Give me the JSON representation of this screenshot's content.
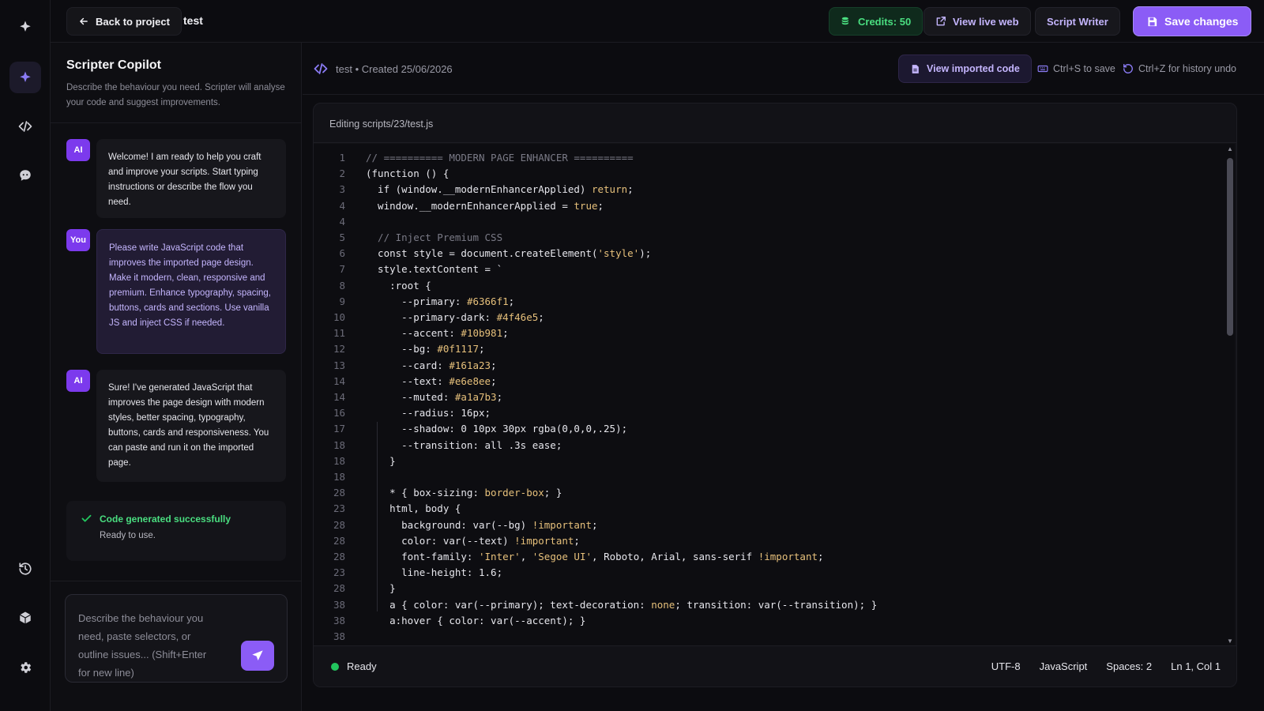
{
  "topbar": {
    "back_label": "Back to project",
    "project_name": "test",
    "credits_label": "Credits: 50",
    "live_label": "View live web",
    "writer_label": "Script Writer",
    "save_label": "Save changes"
  },
  "rail": {
    "items": [
      "logo-icon",
      "copilot-icon",
      "code-icon",
      "chat-icon",
      "history-icon",
      "package-icon",
      "settings-icon"
    ]
  },
  "copilot": {
    "title": "Scripter Copilot",
    "description": "Describe the behaviour you need. Scripter will analyse your code and suggest improvements.",
    "messages": [
      {
        "role": "AI",
        "text": "Welcome! I am ready to help you craft and improve your scripts. Start typing instructions or describe the flow you need."
      },
      {
        "role": "You",
        "text": "Please write JavaScript code that improves the imported page design. Make it modern, clean, responsive and premium. Enhance typography, spacing, buttons, cards and sections. Use vanilla JS and inject CSS if needed."
      },
      {
        "role": "AI",
        "text": "Sure! I've generated JavaScript that improves the page design with modern styles, better spacing, typography, buttons, cards and responsiveness. You can paste and run it on the imported page."
      }
    ],
    "success_title": "Code generated successfully",
    "success_sub": "Ready to use.",
    "input_placeholder": "Describe the behaviour you need, paste selectors, or outline issues... (Shift+Enter for new line)"
  },
  "editor_header": {
    "file_meta": "test • Created 25/06/2026",
    "view_imported_label": "View imported code",
    "save_hint": "Ctrl+S to save",
    "undo_hint": "Ctrl+Z for history undo"
  },
  "editor": {
    "path": "Editing scripts/23/test.js",
    "lines": [
      {
        "n": "1",
        "t": "// ========== MODERN PAGE ENHANCER =========="
      },
      {
        "n": "2",
        "t": "(function () {"
      },
      {
        "n": "3",
        "t": "  if (window.__modernEnhancerApplied) return;"
      },
      {
        "n": "4",
        "t": "  window.__modernEnhancerApplied = true;"
      },
      {
        "n": "4",
        "t": ""
      },
      {
        "n": "5",
        "t": "  // Inject Premium CSS"
      },
      {
        "n": "6",
        "t": "  const style = document.createElement('style');"
      },
      {
        "n": "7",
        "t": "  style.textContent = `"
      },
      {
        "n": "8",
        "t": "    :root {"
      },
      {
        "n": "9",
        "t": "      --primary: #6366f1;"
      },
      {
        "n": "10",
        "t": "      --primary-dark: #4f46e5;"
      },
      {
        "n": "11",
        "t": "      --accent: #10b981;"
      },
      {
        "n": "12",
        "t": "      --bg: #0f1117;"
      },
      {
        "n": "13",
        "t": "      --card: #161a23;"
      },
      {
        "n": "14",
        "t": "      --text: #e6e8ee;"
      },
      {
        "n": "14",
        "t": "      --muted: #a1a7b3;"
      },
      {
        "n": "16",
        "t": "      --radius: 16px;"
      },
      {
        "n": "17",
        "t": "      --shadow: 0 10px 30px rgba(0,0,0,.25);"
      },
      {
        "n": "18",
        "t": "      --transition: all .3s ease;"
      },
      {
        "n": "18",
        "t": "    }"
      },
      {
        "n": "18",
        "t": ""
      },
      {
        "n": "28",
        "t": "    * { box-sizing: border-box; }"
      },
      {
        "n": "23",
        "t": "    html, body {"
      },
      {
        "n": "28",
        "t": "      background: var(--bg) !important;"
      },
      {
        "n": "28",
        "t": "      color: var(--text) !important;"
      },
      {
        "n": "28",
        "t": "      font-family: 'Inter', 'Segoe UI', Roboto, Arial, sans-serif !important;"
      },
      {
        "n": "23",
        "t": "      line-height: 1.6;"
      },
      {
        "n": "28",
        "t": "    }"
      },
      {
        "n": "38",
        "t": "    a { color: var(--primary); text-decoration: none; transition: var(--transition); }"
      },
      {
        "n": "38",
        "t": "    a:hover { color: var(--accent); }"
      },
      {
        "n": "38",
        "t": ""
      }
    ]
  },
  "status": {
    "state": "Ready",
    "encoding": "UTF-8",
    "language": "JavaScript",
    "spaces": "Spaces: 2",
    "cursor": "Ln 1, Col 1"
  },
  "colors": {
    "accent": "#8b5cf6",
    "success": "#22c55e",
    "background": "#0c0c10"
  }
}
